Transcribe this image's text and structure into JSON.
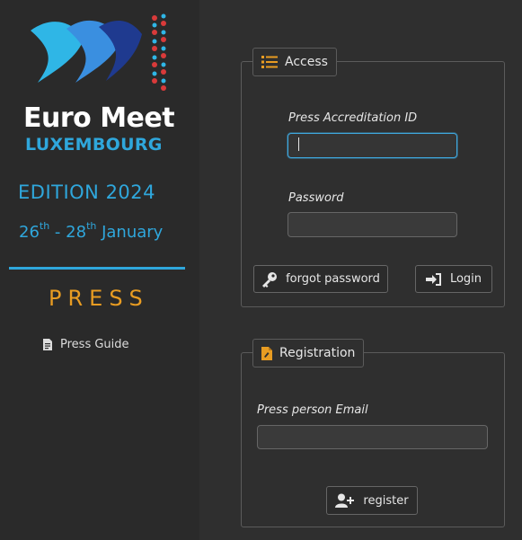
{
  "brand": {
    "line1": "Euro Meet",
    "line2": "LUXEMBOURG",
    "edition": "EDITION 2024",
    "dates": {
      "start_day": "26",
      "start_suffix": "th",
      "separator": " - ",
      "end_day": "28",
      "end_suffix": "th",
      "month": " January"
    },
    "section": "PRESS"
  },
  "sidebar": {
    "press_guide": "Press Guide"
  },
  "access": {
    "legend": "Access",
    "id_label": "Press Accreditation ID",
    "id_value": "",
    "password_label": "Password",
    "password_value": "",
    "forgot_button": "forgot password",
    "login_button": "Login"
  },
  "registration": {
    "legend": "Registration",
    "email_label": "Press person Email",
    "email_value": "",
    "register_button": "register"
  },
  "colors": {
    "accent_blue": "#2fa7dc",
    "accent_orange": "#e89c22",
    "logo_dark_blue": "#1f3a8f",
    "logo_red": "#d93a3a",
    "logo_cyan": "#2fb6e6"
  },
  "icons": [
    "logo-mark",
    "list-icon",
    "document-icon",
    "key-icon",
    "sign-in-icon",
    "file-icon",
    "user-plus-icon"
  ]
}
